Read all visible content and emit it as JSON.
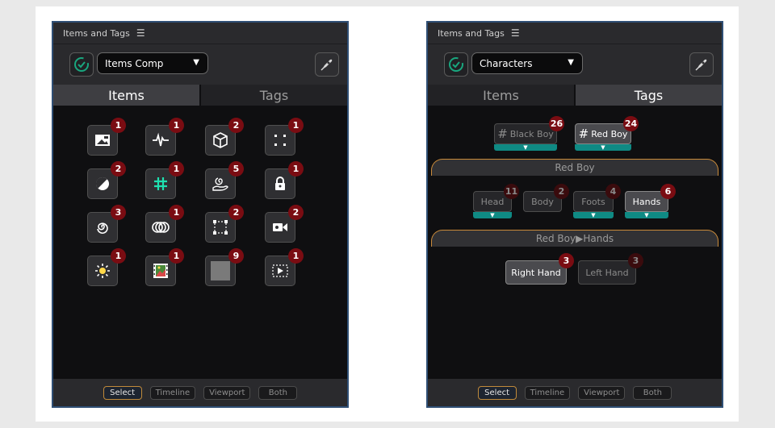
{
  "left": {
    "title": "Items and Tags",
    "dropdown": "Items Comp",
    "tabs": [
      "Items",
      "Tags"
    ],
    "items": [
      {
        "icon": "image-icon",
        "badge": "1"
      },
      {
        "icon": "pulse-icon",
        "badge": "1"
      },
      {
        "icon": "cube-icon",
        "badge": "2"
      },
      {
        "icon": "corners-icon",
        "badge": "1"
      },
      {
        "icon": "contrast-icon",
        "badge": "2"
      },
      {
        "icon": "hashtag-icon",
        "badge": "1"
      },
      {
        "icon": "hand-spiral-icon",
        "badge": "5"
      },
      {
        "icon": "lock-icon",
        "badge": "1"
      },
      {
        "icon": "spiral-icon",
        "badge": "3"
      },
      {
        "icon": "overlap-circles-icon",
        "badge": "1"
      },
      {
        "icon": "dashed-rect-icon",
        "badge": "2"
      },
      {
        "icon": "video-camera-icon",
        "badge": "2"
      },
      {
        "icon": "sun-icon",
        "badge": "1"
      },
      {
        "icon": "film-image-icon",
        "badge": "1"
      },
      {
        "icon": "gray-square-icon",
        "badge": "9"
      },
      {
        "icon": "video-play-icon",
        "badge": "1"
      }
    ],
    "footer": [
      "Select",
      "Timeline",
      "Viewport",
      "Both"
    ]
  },
  "right": {
    "title": "Items and Tags",
    "dropdown": "Characters",
    "tabs": [
      "Items",
      "Tags"
    ],
    "top_tags": [
      {
        "label": "Black Boy",
        "badge": "26"
      },
      {
        "label": "Red Boy",
        "badge": "24"
      }
    ],
    "group1": "Red Boy",
    "body_tags": [
      {
        "label": "Head",
        "badge": "11"
      },
      {
        "label": "Body",
        "badge": "2"
      },
      {
        "label": "Foots",
        "badge": "4"
      },
      {
        "label": "Hands",
        "badge": "6"
      }
    ],
    "group2": "Red Boy▶Hands",
    "hand_tags": [
      {
        "label": "Right Hand",
        "badge": "3"
      },
      {
        "label": "Left Hand",
        "badge": "3"
      }
    ],
    "footer": [
      "Select",
      "Timeline",
      "Viewport",
      "Both"
    ]
  },
  "colors": {
    "accent_teal": "#0f8a84",
    "badge_red": "#7a0c12",
    "group_border": "#c98a3a",
    "panel_border": "#2f4f75"
  }
}
